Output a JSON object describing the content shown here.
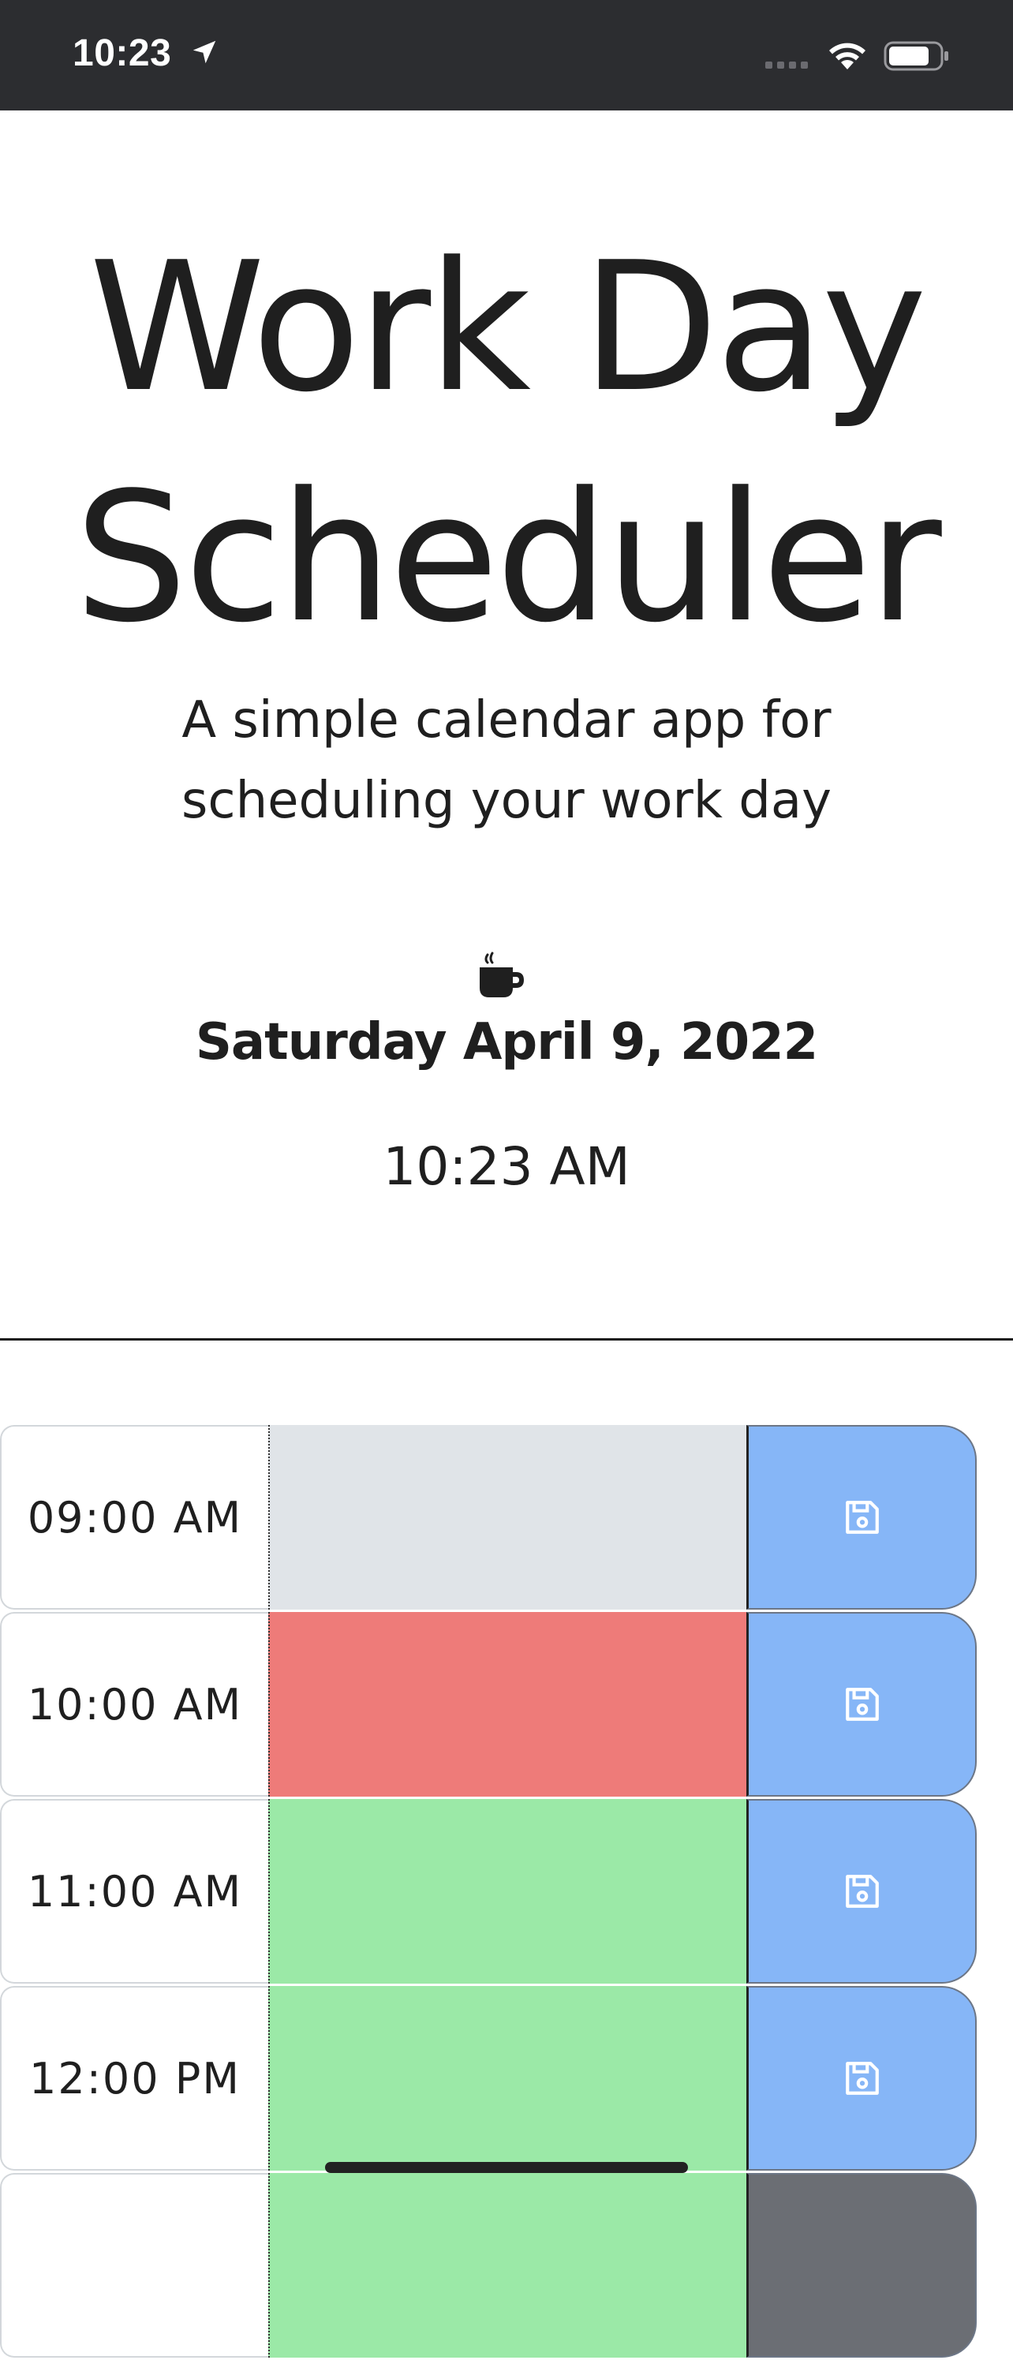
{
  "status_bar": {
    "time": "10:23",
    "icons": [
      "location-arrow-icon",
      "signal-icon",
      "wifi-icon",
      "battery-icon"
    ]
  },
  "header": {
    "title_line1": "Work Day",
    "title_line2": "Scheduler",
    "subtitle_line1": "A simple calendar app for",
    "subtitle_line2": "scheduling your work day",
    "icon": "coffee-cup-icon",
    "date": "Saturday April 9, 2022",
    "time": "10:23 AM"
  },
  "schedule": {
    "rows": [
      {
        "hour": "09:00 AM",
        "text": "",
        "state": "past",
        "color": "#e0e4e8"
      },
      {
        "hour": "10:00 AM",
        "text": "",
        "state": "present",
        "color": "#ee7b79"
      },
      {
        "hour": "11:00 AM",
        "text": "",
        "state": "future",
        "color": "#9be9a7"
      },
      {
        "hour": "12:00 PM",
        "text": "",
        "state": "future",
        "color": "#9be9a7"
      },
      {
        "hour": "",
        "text": "",
        "state": "future",
        "color": "#9be9a7"
      }
    ],
    "save_icon": "floppy-disk-icon",
    "save_color": "#86b6f7"
  }
}
